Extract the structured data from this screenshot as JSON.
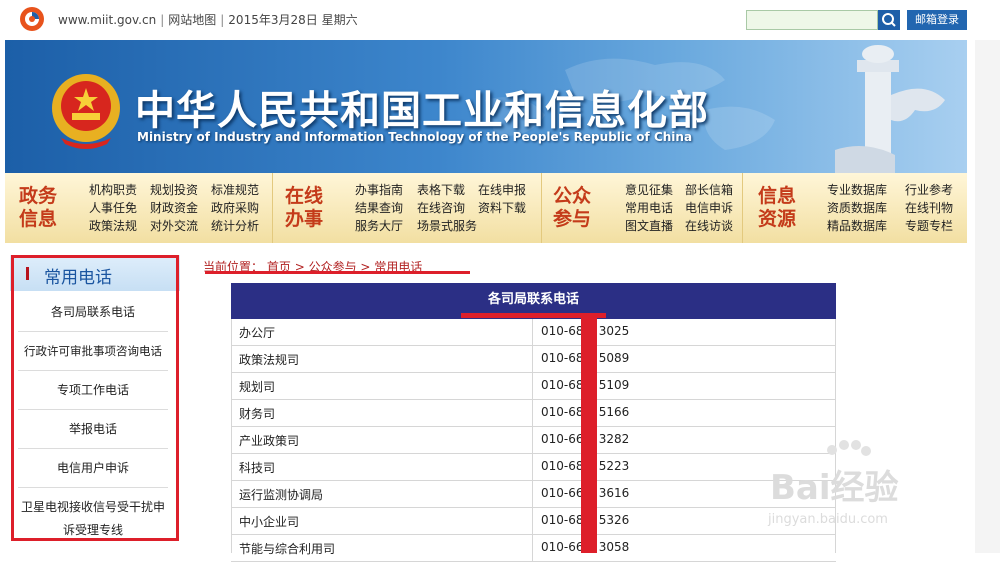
{
  "topbar": {
    "site": "www.miit.gov.cn",
    "sitemap": "网站地图",
    "date": "2015年3月28日",
    "weekday": "星期六",
    "search_placeholder": "",
    "mail_login": "邮箱登录"
  },
  "banner": {
    "title_cn": "中华人民共和国工业和信息化部",
    "title_en": "Ministry of Industry and Information Technology of the People's Republic of China"
  },
  "nav": [
    {
      "head": [
        "政务",
        "信息"
      ],
      "cols": [
        [
          "机构职责",
          "人事任免",
          "政策法规"
        ],
        [
          "规划投资",
          "财政资金",
          "对外交流"
        ],
        [
          "标准规范",
          "政府采购",
          "统计分析"
        ]
      ]
    },
    {
      "head": [
        "在线",
        "办事"
      ],
      "cols": [
        [
          "办事指南",
          "结果查询",
          "服务大厅"
        ],
        [
          "表格下载",
          "在线咨询",
          "场景式服务"
        ],
        [
          "在线申报",
          "资料下载",
          ""
        ]
      ]
    },
    {
      "head": [
        "公众",
        "参与"
      ],
      "cols": [
        [
          "意见征集",
          "常用电话",
          "图文直播"
        ],
        [
          "部长信箱",
          "电信申诉",
          "在线访谈"
        ]
      ]
    },
    {
      "head": [
        "信息",
        "资源"
      ],
      "cols": [
        [
          "专业数据库",
          "资质数据库",
          "精品数据库"
        ],
        [
          "行业参考",
          "在线刊物",
          "专题专栏"
        ]
      ]
    }
  ],
  "sidebar": {
    "title": "常用电话",
    "items": [
      "各司局联系电话",
      "行政许可审批事项咨询电话",
      "专项工作电话",
      "举报电话",
      "电信用户申诉",
      "卫星电视接收信号受干扰申诉受理专线"
    ]
  },
  "breadcrumb": {
    "prefix": "当前位置：",
    "home": "首页",
    "sep": ">",
    "level1": "公众参与",
    "level2": "常用电话"
  },
  "table": {
    "header": "各司局联系电话",
    "rows": [
      {
        "dept": "办公厅",
        "phone": "010-68    3025"
      },
      {
        "dept": "政策法规司",
        "phone": "010-68    5089"
      },
      {
        "dept": "规划司",
        "phone": "010-68    5109"
      },
      {
        "dept": "财务司",
        "phone": "010-68    5166"
      },
      {
        "dept": "产业政策司",
        "phone": "010-66    3282"
      },
      {
        "dept": "科技司",
        "phone": "010-68    5223"
      },
      {
        "dept": "运行监测协调局",
        "phone": "010-66    3616"
      },
      {
        "dept": "中小企业司",
        "phone": "010-68    5326"
      },
      {
        "dept": "节能与综合利用司",
        "phone": "010-66    3058"
      }
    ]
  },
  "watermark": {
    "main": "Bai经验",
    "sub": "jingyan.baidu.com"
  },
  "colors": {
    "nav_head": "#c43b1a",
    "table_head": "#2b2f85",
    "annotation_red": "#dd1f2a",
    "link_red": "#b22222"
  }
}
